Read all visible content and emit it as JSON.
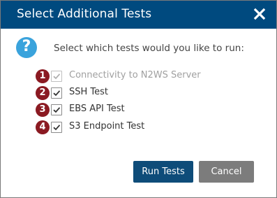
{
  "dialog": {
    "title": "Select Additional Tests",
    "prompt": "Select which tests would you like to run:",
    "tests": [
      {
        "number": "1",
        "label": "Connectivity to N2WS Server",
        "checked": true,
        "disabled": true
      },
      {
        "number": "2",
        "label": "SSH Test",
        "checked": true,
        "disabled": false
      },
      {
        "number": "3",
        "label": "EBS API Test",
        "checked": true,
        "disabled": false
      },
      {
        "number": "4",
        "label": "S3 Endpoint Test",
        "checked": true,
        "disabled": false
      }
    ],
    "buttons": {
      "run": "Run Tests",
      "cancel": "Cancel"
    }
  },
  "colors": {
    "titlebar": "#004a7f",
    "badge": "#8b1a22",
    "info_icon": "#3aa3dc",
    "primary_button": "#0e4c79",
    "secondary_button": "#7c7c7c"
  },
  "icons": {
    "close": "close-icon",
    "info": "question-icon",
    "check": "checkmark-icon"
  }
}
